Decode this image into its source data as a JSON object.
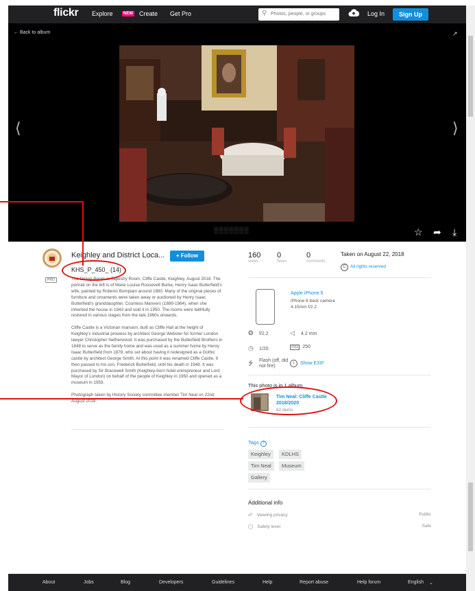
{
  "nav": {
    "logo": "flickr",
    "explore": "Explore",
    "new_badge": "NEW",
    "create": "Create",
    "get_pro": "Get Pro",
    "search_placeholder": "Photos, people, or groups",
    "login": "Log In",
    "signup": "Sign Up"
  },
  "stage": {
    "back_label": "← Back to album"
  },
  "owner": {
    "name": "Keighley and District Loca...",
    "follow_label": "+ Follow",
    "pro_badge": "PRO"
  },
  "photo": {
    "title": "KHS_P_450_ (14)",
    "description": [
      "The Dining Room or Tapestry Room, Cliffe Castle, Keighley, August 2018. The portrait on the left is of Marie Louise Roosevelt Burke, Henry Isaac Butterfield's wife, painted by Roberto Bompiani around 1880. Many of the original pieces of furniture and ornaments were taken away or auctioned by Henry Isaac Butterfield's granddaughter, Countess Manvers (1889-1984), when she inherited the house in 1943 and sold it in 1950. The rooms were faithfully restored in various stages from the late 1980s onwards.",
      "Cliffe Castle is a Victorian mansion, built as Cliffe Hall at the height of Keighley's industrial prowess by architect George Webster for former London lawyer Christopher Netherwood. It was purchased by the Butterfield Brothers in 1848 to serve as the family home and was used as a summer home by Henry Isaac Butterfield from 1878, who set about having it redesigned as a Gothic castle by architect George Smith. At this point it was renamed Cliffe Castle. It then passed to his son, Frederick Butterfield, until his death in 1948. It was purchased by Sir Bracewell Smith (Keighley-born hotel entrepreneur and Lord Mayor of London) on behalf of the people of Keighley in 1950 and opened as a museum in 1959.",
      "Photograph taken by History Society committee member Tim Neal on 22nd August 2018."
    ]
  },
  "stats": {
    "views": "160",
    "views_label": "views",
    "faves": "0",
    "faves_label": "faves",
    "comments": "0",
    "comments_label": "comments",
    "taken_on": "Taken on August 22, 2018",
    "license": "All rights reserved"
  },
  "camera": {
    "name": "Apple iPhone 6",
    "detail": "iPhone 6 back camera 4.15mm f/2.2",
    "aperture": "f/2.2",
    "focal_length": "4.2 mm",
    "shutter": "1/20",
    "iso": "250",
    "flash": "Flash (off, did not fire)",
    "show_exif": "Show EXIF"
  },
  "album": {
    "header": "This photo is in 1 album",
    "name": "Tim Neal: Cliffe Castle 2018/2020",
    "count": "62 items"
  },
  "tags": {
    "header": "Tags",
    "items": [
      "Keighley",
      "KDLHS",
      "Tim Neal",
      "Museum",
      "Gallery"
    ]
  },
  "additional": {
    "header": "Additional info",
    "privacy_label": "Viewing privacy",
    "privacy_value": "Public",
    "safety_label": "Safety level",
    "safety_value": "Safe"
  },
  "footer": {
    "links": [
      "About",
      "Jobs",
      "Blog",
      "Developers",
      "Guidelines",
      "Help",
      "Report abuse",
      "Help forum",
      "English"
    ]
  },
  "colors": {
    "accent": "#128fdc",
    "annotation": "#e01010",
    "nav_bg": "#212124"
  }
}
